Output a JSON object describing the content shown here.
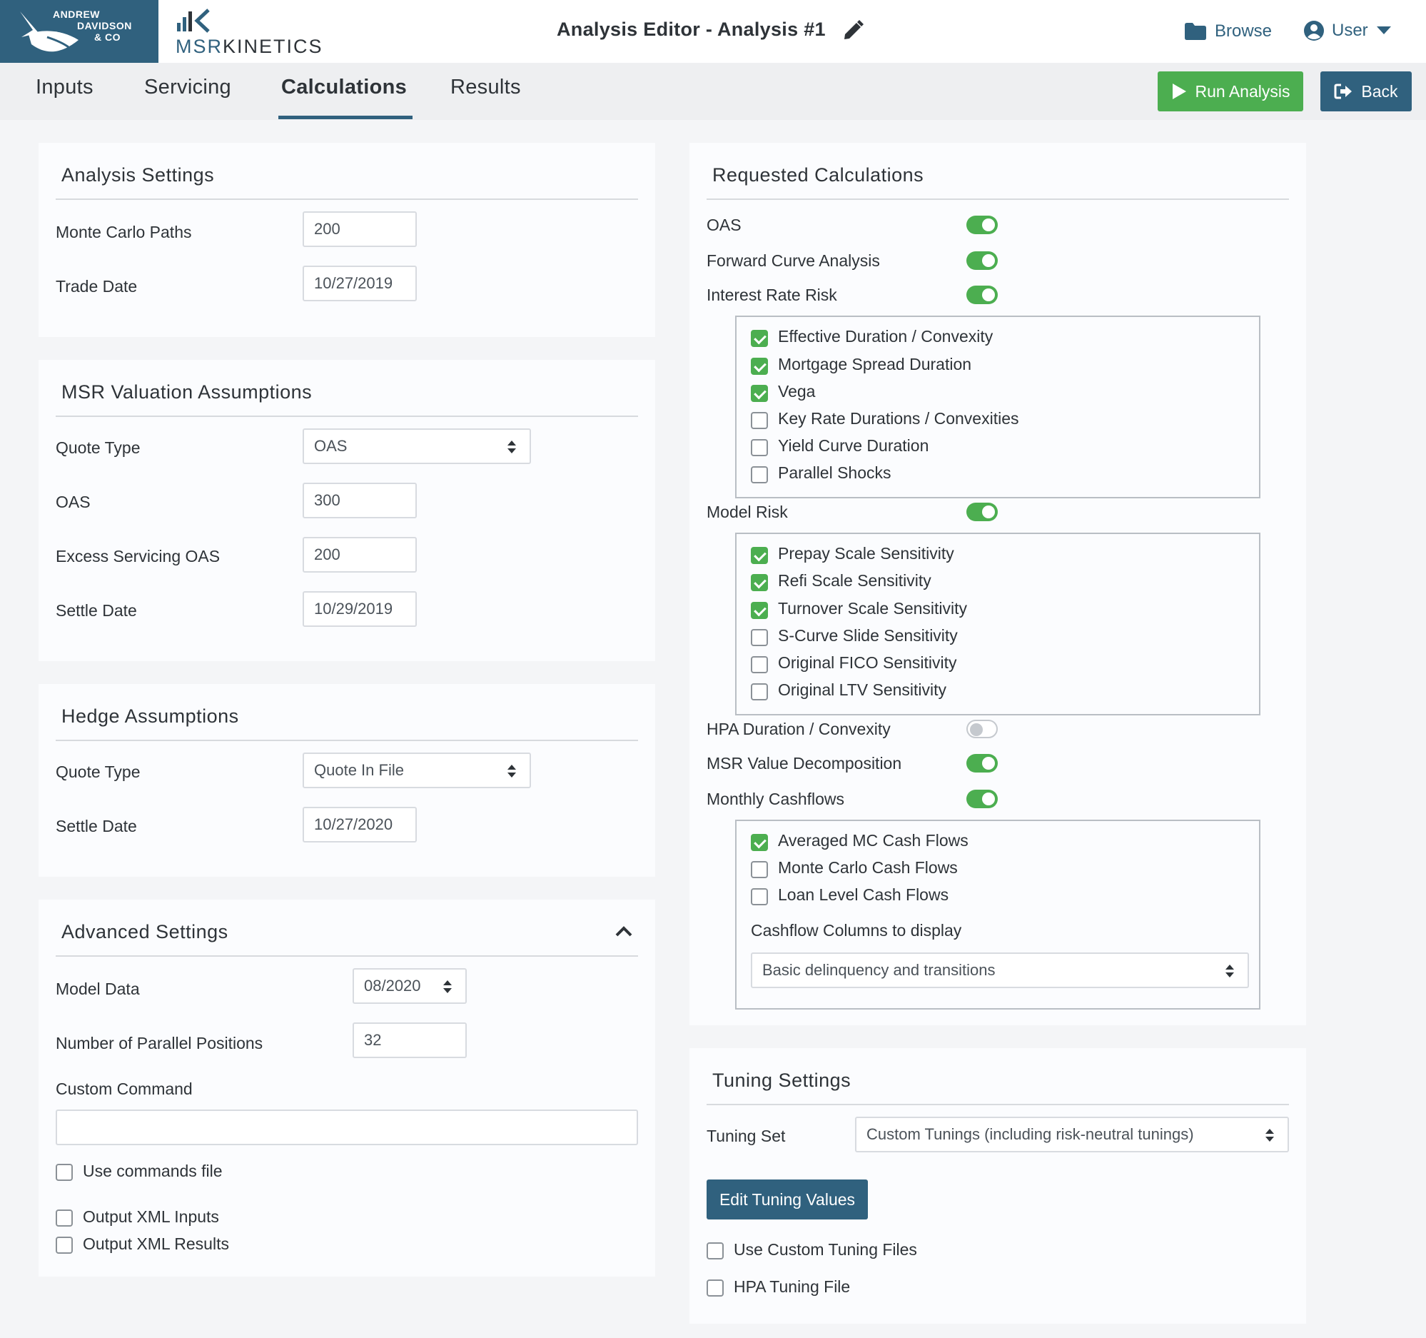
{
  "header": {
    "company_lines": [
      "ANDREW",
      "DAVIDSON",
      "& CO"
    ],
    "product_prefix": "MSR",
    "product_suffix": "KINETICS",
    "title": "Analysis Editor - Analysis #1",
    "browse_label": "Browse",
    "user_label": "User"
  },
  "tabs": [
    {
      "label": "Inputs"
    },
    {
      "label": "Servicing"
    },
    {
      "label": "Calculations"
    },
    {
      "label": "Results"
    }
  ],
  "active_tab": "Calculations",
  "actions": {
    "run_label": "Run Analysis",
    "back_label": "Back"
  },
  "analysis_settings": {
    "title": "Analysis Settings",
    "monte_carlo_label": "Monte Carlo Paths",
    "monte_carlo_value": "200",
    "trade_date_label": "Trade Date",
    "trade_date_value": "10/27/2019"
  },
  "msr_valuation": {
    "title": "MSR Valuation Assumptions",
    "quote_type_label": "Quote Type",
    "quote_type_value": "OAS",
    "oas_label": "OAS",
    "oas_value": "300",
    "excess_oas_label": "Excess Servicing OAS",
    "excess_oas_value": "200",
    "settle_date_label": "Settle Date",
    "settle_date_value": "10/29/2019"
  },
  "hedge": {
    "title": "Hedge Assumptions",
    "quote_type_label": "Quote Type",
    "quote_type_value": "Quote In File",
    "settle_date_label": "Settle Date",
    "settle_date_value": "10/27/2020"
  },
  "advanced": {
    "title": "Advanced Settings",
    "model_data_label": "Model Data",
    "model_data_value": "08/2020",
    "parallel_label": "Number of Parallel Positions",
    "parallel_value": "32",
    "custom_command_label": "Custom Command",
    "custom_command_value": "",
    "use_commands_file": {
      "label": "Use commands file",
      "checked": false
    },
    "output_xml_inputs": {
      "label": "Output XML Inputs",
      "checked": false
    },
    "output_xml_results": {
      "label": "Output XML Results",
      "checked": false
    }
  },
  "requested": {
    "title": "Requested Calculations",
    "oas": {
      "label": "OAS",
      "on": true
    },
    "forward_curve": {
      "label": "Forward Curve Analysis",
      "on": true
    },
    "interest_rate_risk": {
      "label": "Interest Rate Risk",
      "on": true
    },
    "irr_options": [
      {
        "label": "Effective Duration / Convexity",
        "checked": true
      },
      {
        "label": "Mortgage Spread Duration",
        "checked": true
      },
      {
        "label": "Vega",
        "checked": true
      },
      {
        "label": "Key Rate Durations / Convexities",
        "checked": false
      },
      {
        "label": "Yield Curve Duration",
        "checked": false
      },
      {
        "label": "Parallel Shocks",
        "checked": false
      }
    ],
    "model_risk": {
      "label": "Model Risk",
      "on": true
    },
    "model_risk_options": [
      {
        "label": "Prepay Scale Sensitivity",
        "checked": true
      },
      {
        "label": "Refi Scale Sensitivity",
        "checked": true
      },
      {
        "label": "Turnover Scale Sensitivity",
        "checked": true
      },
      {
        "label": "S-Curve Slide Sensitivity",
        "checked": false
      },
      {
        "label": "Original FICO Sensitivity",
        "checked": false
      },
      {
        "label": "Original LTV Sensitivity",
        "checked": false
      }
    ],
    "hpa": {
      "label": "HPA Duration / Convexity",
      "on": false
    },
    "msr_decomposition": {
      "label": "MSR Value Decomposition",
      "on": true
    },
    "monthly_cashflows": {
      "label": "Monthly Cashflows",
      "on": true
    },
    "cashflow_options": [
      {
        "label": "Averaged MC Cash Flows",
        "checked": true
      },
      {
        "label": "Monte Carlo Cash Flows",
        "checked": false
      },
      {
        "label": "Loan Level Cash Flows",
        "checked": false
      }
    ],
    "cashflow_columns_label": "Cashflow Columns to display",
    "cashflow_columns_value": "Basic delinquency and transitions"
  },
  "tuning": {
    "title": "Tuning Settings",
    "tuning_set_label": "Tuning Set",
    "tuning_set_value": "Custom Tunings (including risk-neutral tunings)",
    "edit_button_label": "Edit Tuning Values",
    "use_custom_files": {
      "label": "Use Custom Tuning Files",
      "checked": false
    },
    "hpa_tuning_file": {
      "label": "HPA Tuning File",
      "checked": false
    }
  },
  "colors": {
    "brand": "#30617e",
    "success": "#4cae50",
    "text": "#2e3338"
  }
}
